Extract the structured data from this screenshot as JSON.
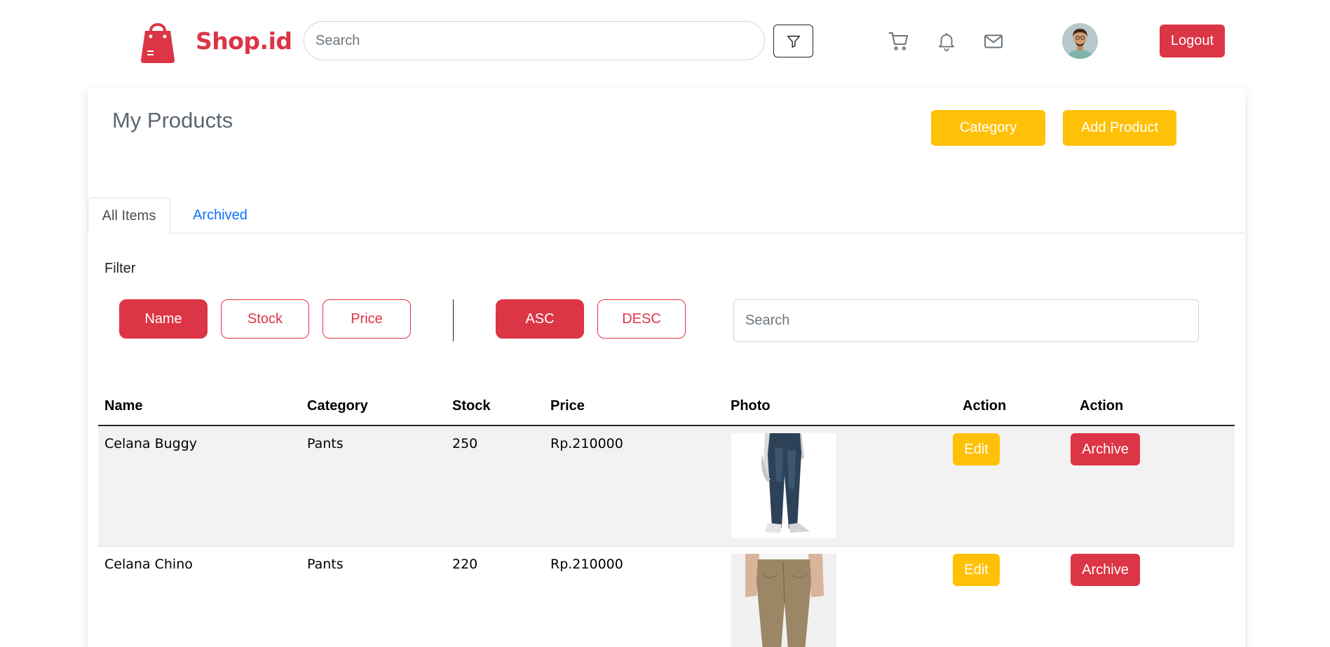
{
  "brand": {
    "name": "Shop.id",
    "logo_icon": "shopping-bag-icon",
    "color": "#dc3545"
  },
  "header": {
    "search_placeholder": "Search",
    "filter_icon": "funnel-icon",
    "icons": [
      "cart-icon",
      "bell-icon",
      "mail-icon"
    ],
    "avatar": "user-avatar",
    "logout_label": "Logout"
  },
  "main": {
    "title": "My Products",
    "category_label": "Category",
    "add_product_label": "Add Product",
    "tabs": [
      {
        "label": "All Items",
        "active": true
      },
      {
        "label": "Archived",
        "active": false
      }
    ],
    "filter": {
      "label": "Filter",
      "sort_fields": [
        {
          "label": "Name",
          "selected": true
        },
        {
          "label": "Stock",
          "selected": false
        },
        {
          "label": "Price",
          "selected": false
        }
      ],
      "order": [
        {
          "label": "ASC",
          "selected": true
        },
        {
          "label": "DESC",
          "selected": false
        }
      ],
      "search_placeholder": "Search"
    },
    "table": {
      "columns": [
        "Name",
        "Category",
        "Stock",
        "Price",
        "Photo",
        "Action",
        "Action"
      ],
      "rows": [
        {
          "name": "Celana Buggy",
          "category": "Pants",
          "stock": "250",
          "price": "Rp.210000",
          "photo": "baggy-jeans-photo",
          "edit": "Edit",
          "archive": "Archive"
        },
        {
          "name": "Celana Chino",
          "category": "Pants",
          "stock": "220",
          "price": "Rp.210000",
          "photo": "chino-pants-photo",
          "edit": "Edit",
          "archive": "Archive"
        }
      ]
    }
  },
  "colors": {
    "primary_red": "#dc3545",
    "accent_yellow": "#ffc107",
    "link_blue": "#0d6efd"
  }
}
